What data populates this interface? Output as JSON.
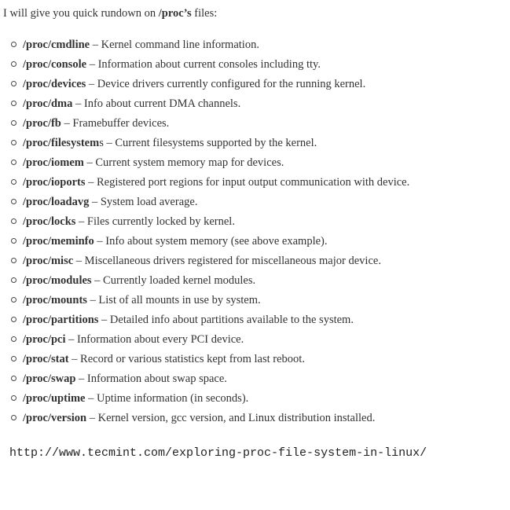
{
  "intro": {
    "prefix": "I will give you quick rundown on ",
    "bold": "/proc’s",
    "suffix": " files:"
  },
  "items": [
    {
      "path": "/proc/cmdline",
      "rest": "",
      "desc": " – Kernel command line information."
    },
    {
      "path": "/proc/console",
      "rest": "",
      "desc": " – Information about current consoles including tty."
    },
    {
      "path": "/proc/devices",
      "rest": "",
      "desc": " – Device drivers currently configured for the running kernel."
    },
    {
      "path": "/proc/dma",
      "rest": "",
      "desc": " – Info about current DMA channels."
    },
    {
      "path": "/proc/fb",
      "rest": "",
      "desc": " – Framebuffer devices."
    },
    {
      "path": "/proc/filesystem",
      "rest": "s",
      "desc": " – Current filesystems supported by the kernel."
    },
    {
      "path": "/proc/iomem",
      "rest": "",
      "desc": " – Current system memory map for devices."
    },
    {
      "path": "/proc/ioports",
      "rest": "",
      "desc": " – Registered port regions for input output communication with device."
    },
    {
      "path": "/proc/loadavg",
      "rest": "",
      "desc": " – System load average."
    },
    {
      "path": "/proc/locks",
      "rest": "",
      "desc": " – Files currently locked by kernel."
    },
    {
      "path": "/proc/meminfo",
      "rest": "",
      "desc": " – Info about system memory (see above example)."
    },
    {
      "path": "/proc/misc",
      "rest": "",
      "desc": " – Miscellaneous drivers registered for miscellaneous major device."
    },
    {
      "path": "/proc/modules",
      "rest": "",
      "desc": " – Currently loaded kernel modules."
    },
    {
      "path": "/proc/mounts",
      "rest": "",
      "desc": " – List of all mounts in use by system."
    },
    {
      "path": "/proc/partitions",
      "rest": "",
      "desc": " – Detailed info about partitions available to the system."
    },
    {
      "path": "/proc/pci",
      "rest": "",
      "desc": " – Information about every PCI device."
    },
    {
      "path": "/proc/stat",
      "rest": "",
      "desc": " – Record or various statistics kept from last reboot."
    },
    {
      "path": "/proc/swap",
      "rest": "",
      "desc": " – Information about swap space."
    },
    {
      "path": "/proc/uptime",
      "rest": "",
      "desc": " – Uptime information (in seconds)."
    },
    {
      "path": "/proc/version",
      "rest": "",
      "desc": " – Kernel version, gcc version, and Linux distribution installed."
    }
  ],
  "source_url": "http://www.tecmint.com/exploring-proc-file-system-in-linux/"
}
